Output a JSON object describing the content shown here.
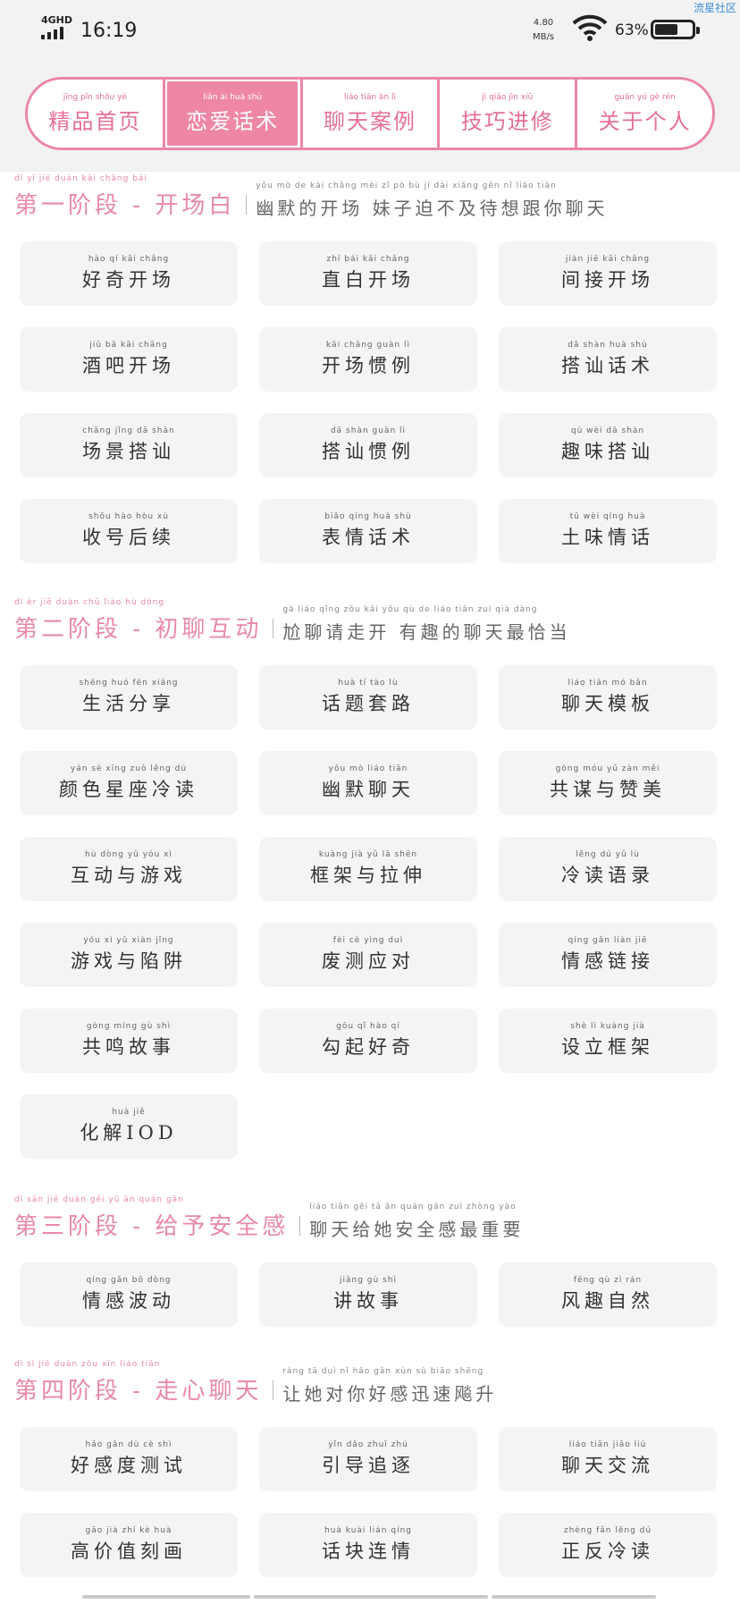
{
  "status": {
    "network": "4GHD",
    "time": "16:19",
    "speed_value": "4.80",
    "speed_unit": "MB/s",
    "battery": "63%",
    "battery_level": 0.63,
    "corner": "流星社区"
  },
  "nav": {
    "tabs": [
      {
        "label": "精品首页",
        "pinyin": "jīng pǐn shǒu yè",
        "active": false
      },
      {
        "label": "恋爱话术",
        "pinyin": "liàn ài huà shù",
        "active": true
      },
      {
        "label": "聊天案例",
        "pinyin": "liáo tiān àn lì",
        "active": false
      },
      {
        "label": "技巧进修",
        "pinyin": "jì qiǎo jìn xiū",
        "active": false
      },
      {
        "label": "关于个人",
        "pinyin": "guān yú gè rén",
        "active": false
      }
    ]
  },
  "sections": [
    {
      "title": "第一阶段 - 开场白",
      "title_pinyin": "dì yī jiē duàn       kāi chǎng bái",
      "subtitle": "幽默的开场 妹子迫不及待想跟你聊天",
      "subtitle_pinyin": "yōu mò de kāi chǎng  mèi zǐ pò bù jí dài xiǎng gēn nǐ liáo tiān",
      "items": [
        {
          "label": "好奇开场",
          "pinyin": "hào qí kāi chǎng"
        },
        {
          "label": "直白开场",
          "pinyin": "zhí bái kāi chǎng"
        },
        {
          "label": "间接开场",
          "pinyin": "jiàn jiē kāi chǎng"
        },
        {
          "label": "酒吧开场",
          "pinyin": "jiǔ bā kāi chǎng"
        },
        {
          "label": "开场惯例",
          "pinyin": "kāi chǎng guàn lì"
        },
        {
          "label": "搭讪话术",
          "pinyin": "dā shàn huà shù"
        },
        {
          "label": "场景搭讪",
          "pinyin": "chǎng jǐng dā shàn"
        },
        {
          "label": "搭讪惯例",
          "pinyin": "dā shàn guàn lì"
        },
        {
          "label": "趣味搭讪",
          "pinyin": "qù wèi dā shàn"
        },
        {
          "label": "收号后续",
          "pinyin": "shōu hào hòu xù"
        },
        {
          "label": "表情话术",
          "pinyin": "biǎo qíng huà shù"
        },
        {
          "label": "土味情话",
          "pinyin": "tǔ wèi qíng huà"
        }
      ]
    },
    {
      "title": "第二阶段 - 初聊互动",
      "title_pinyin": "dì èr jiē duàn       chū liáo hù dòng",
      "subtitle": "尬聊请走开 有趣的聊天最恰当",
      "subtitle_pinyin": "gà liáo qǐng zǒu kāi  yǒu qù de liáo tiān zuì qià dàng",
      "items": [
        {
          "label": "生活分享",
          "pinyin": "shēng huó fēn xiǎng"
        },
        {
          "label": "话题套路",
          "pinyin": "huà tí tào lù"
        },
        {
          "label": "聊天模板",
          "pinyin": "liáo tiān mó bǎn"
        },
        {
          "label": "颜色星座冷读",
          "pinyin": "yán sè xīng zuò lěng dú"
        },
        {
          "label": "幽默聊天",
          "pinyin": "yōu mò liáo tiān"
        },
        {
          "label": "共谋与赞美",
          "pinyin": "gòng móu yǔ zàn měi"
        },
        {
          "label": "互动与游戏",
          "pinyin": "hù dòng yǔ yóu xì"
        },
        {
          "label": "框架与拉伸",
          "pinyin": "kuàng jià yǔ lā shēn"
        },
        {
          "label": "冷读语录",
          "pinyin": "lěng dú yǔ lù"
        },
        {
          "label": "游戏与陷阱",
          "pinyin": "yóu xì yǔ xiàn jǐng"
        },
        {
          "label": "废测应对",
          "pinyin": "fèi cè yìng duì"
        },
        {
          "label": "情感链接",
          "pinyin": "qíng gǎn liàn jiē"
        },
        {
          "label": "共鸣故事",
          "pinyin": "gòng míng gù shì"
        },
        {
          "label": "勾起好奇",
          "pinyin": "gōu qǐ hào qí"
        },
        {
          "label": "设立框架",
          "pinyin": "shè lì kuàng jià"
        },
        {
          "label": "化解IOD",
          "pinyin": "huà jiě"
        }
      ]
    },
    {
      "title": "第三阶段 - 给予安全感",
      "title_pinyin": "dì sān jiē duàn       gěi yǔ ān quán gǎn",
      "subtitle": "聊天给她安全感最重要",
      "subtitle_pinyin": "liáo tiān gěi tā ān quán gǎn zuì zhòng yào",
      "items": [
        {
          "label": "情感波动",
          "pinyin": "qíng gǎn bō dòng"
        },
        {
          "label": "讲故事",
          "pinyin": "jiǎng gù shì"
        },
        {
          "label": "风趣自然",
          "pinyin": "fēng qù zì rán"
        }
      ]
    },
    {
      "title": "第四阶段 - 走心聊天",
      "title_pinyin": "dì sì jiē duàn       zǒu xīn liáo tiān",
      "subtitle": "让她对你好感迅速飚升",
      "subtitle_pinyin": "ràng tā duì nǐ hǎo gǎn xùn sù biāo shēng",
      "items": [
        {
          "label": "好感度测试",
          "pinyin": "hǎo gǎn dù cè shì"
        },
        {
          "label": "引导追逐",
          "pinyin": "yǐn dǎo zhuī zhú"
        },
        {
          "label": "聊天交流",
          "pinyin": "liáo tiān jiāo liú"
        },
        {
          "label": "高价值刻画",
          "pinyin": "gāo jià zhí kè huà"
        },
        {
          "label": "话块连情",
          "pinyin": "huà kuài lián qíng"
        },
        {
          "label": "正反冷读",
          "pinyin": "zhèng fǎn lěng dú"
        }
      ]
    }
  ]
}
